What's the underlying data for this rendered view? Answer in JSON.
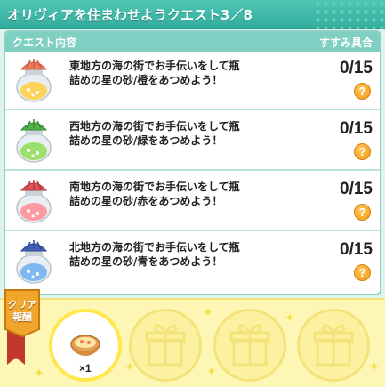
{
  "title": "オリヴィアを住まわせようクエスト3／8",
  "panel": {
    "col_content": "クエスト内容",
    "col_progress": "すすみ具合"
  },
  "quests": [
    {
      "text": "東地方の海の街でお手伝いをして瓶詰めの星の砂/橙をあつめよう！",
      "progress": "0/15",
      "cap": "#ef7a5a",
      "sand": "#ffd35a"
    },
    {
      "text": "西地方の海の街でお手伝いをして瓶詰めの星の砂/緑をあつめよう！",
      "progress": "0/15",
      "cap": "#52b34c",
      "sand": "#9be06e"
    },
    {
      "text": "南地方の海の街でお手伝いをして瓶詰めの星の砂/赤をあつめよう！",
      "progress": "0/15",
      "cap": "#e0555a",
      "sand": "#ff9aa0"
    },
    {
      "text": "北地方の海の街でお手伝いをして瓶詰めの星の砂/青をあつめよう！",
      "progress": "0/15",
      "cap": "#4560b8",
      "sand": "#7fb8f0"
    }
  ],
  "help_label": "?",
  "reward": {
    "badge": "クリア報酬",
    "item_count": "×1"
  }
}
